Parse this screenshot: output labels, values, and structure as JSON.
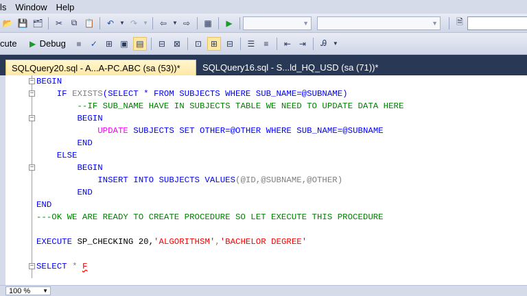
{
  "menu": [
    "ls",
    "Window",
    "Help"
  ],
  "toolbar1": {
    "icons": [
      "open-icon",
      "save-icon",
      "save-all-icon",
      "cut-icon",
      "copy-icon",
      "paste-icon",
      "undo-icon",
      "redo-icon",
      "navigate-back-icon",
      "navigate-forward-icon",
      "activity-monitor-icon",
      "run-icon",
      "properties-icon"
    ]
  },
  "toolbar2": {
    "execute_label": "cute",
    "debug_label": "Debug",
    "icons": [
      "stop-icon",
      "check-icon",
      "parse-icon",
      "display-plan-icon",
      "query-options-icon",
      "results-text-icon",
      "results-grid-icon",
      "results-file-icon",
      "comment-icon",
      "uncomment-icon",
      "decrease-indent-icon",
      "increase-indent-icon",
      "specify-values-icon"
    ]
  },
  "tabs": [
    {
      "label": "SQLQuery20.sql - A...A-PC.ABC (sa (53))*",
      "active": true
    },
    {
      "label": "SQLQuery16.sql - S...ld_HQ_USD (sa (71))*",
      "active": false
    }
  ],
  "code": {
    "l1": "BEGIN",
    "l2_kw1": "IF",
    "l2_fn": "EXISTS",
    "l2_rest": "(SELECT * FROM SUBJECTS WHERE SUB_NAME=@SUBNAME)",
    "l3": "--IF SUB_NAME HAVE IN SUBJECTS TABLE WE NEED TO UPDATE DATA HERE",
    "l4": "BEGIN",
    "l5_fn": "UPDATE",
    "l5_kw1": "SUBJECTS",
    "l5_set": "SET",
    "l5_rest": "OTHER=@OTHER",
    "l5_where": "WHERE",
    "l5_tail": "SUB_NAME=@SUBNAME",
    "l6": "END",
    "l7": "ELSE",
    "l8": "BEGIN",
    "l9_ins": "INSERT INTO",
    "l9_tbl": "SUBJECTS",
    "l9_vals": "VALUES",
    "l9_args": "(@ID,@SUBNAME,@OTHER)",
    "l10": "END",
    "l11": "END",
    "l12": "---OK WE ARE READY TO CREATE PROCEDURE SO LET EXECUTE THIS PROCEDURE",
    "l13_exec": "EXECUTE",
    "l13_proc": "SP_CHECKING",
    "l13_num": "20,",
    "l13_s1": "'ALGORITHSM'",
    "l13_comma": ",",
    "l13_s2": "'BACHELOR DEGREE'",
    "l14_sel": "SELECT",
    "l14_star": "*",
    "l14_f": "F"
  },
  "status": {
    "zoom": "100 %"
  },
  "colors": {
    "keyword": "#0000ff",
    "string": "#ff0000",
    "comment": "#008000",
    "function": "#ff00ff",
    "tab_active": "#ffe8a6",
    "tabstrip": "#293955"
  }
}
